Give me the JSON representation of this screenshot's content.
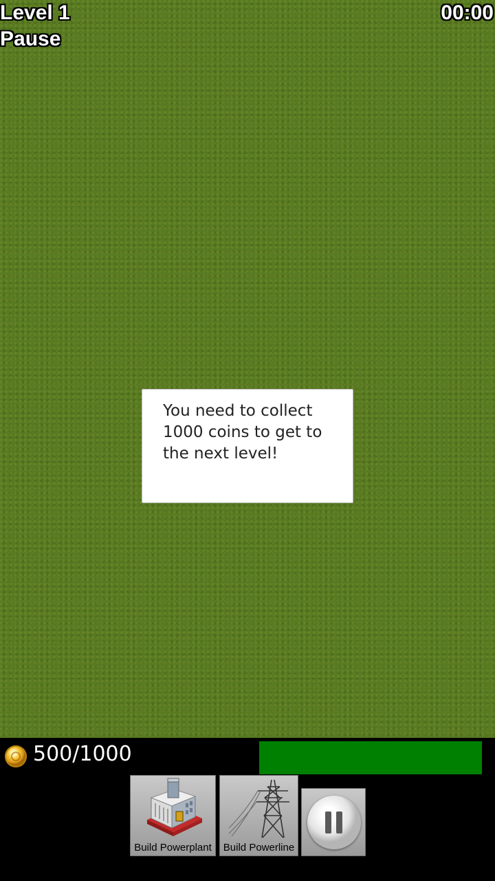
{
  "hud": {
    "level": "Level 1",
    "pause": "Pause",
    "timer": "00:00"
  },
  "dialog": {
    "message": "You need to collect 1000 coins to get to the next level!"
  },
  "bottom_bar": {
    "coins_text": "500/1000",
    "coins_current": 500,
    "coins_goal": 1000,
    "progress_fraction": 1.0,
    "progress_color": "#008000",
    "coin_icon": "coin-icon",
    "buttons": [
      {
        "label": "Build Powerplant",
        "icon": "powerplant-icon"
      },
      {
        "label": "Build Powerline",
        "icon": "powerline-tower-icon"
      },
      {
        "label": "",
        "icon": "pause-icon"
      }
    ]
  },
  "colors": {
    "grass": "#557a22",
    "bar_background": "#000000"
  }
}
